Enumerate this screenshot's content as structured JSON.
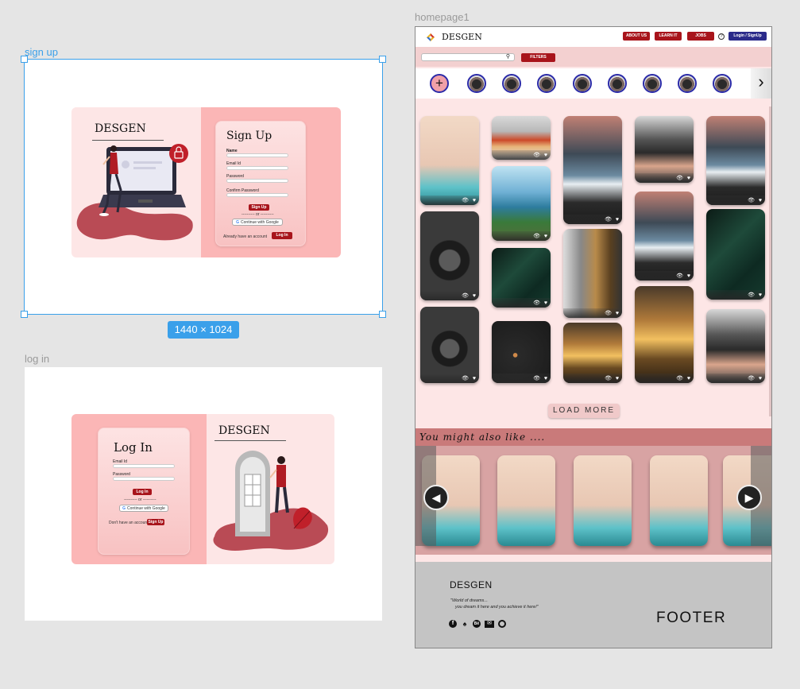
{
  "canvas": {
    "signup_label": "sign up",
    "login_label": "log in",
    "homepage_label": "homepage1",
    "size_tag": "1440 × 1024"
  },
  "signup": {
    "brand": "DESGEN",
    "title": "Sign Up",
    "fields": [
      "Name",
      "Email Id",
      "Password",
      "Confirm Password"
    ],
    "submit": "Sign Up",
    "or": "---------- or ----------",
    "google": "Continue with Google",
    "already": "Already have an account",
    "login_btn": "Log In"
  },
  "login": {
    "brand": "DESGEN",
    "title": "Log In",
    "fields": [
      "Email Id",
      "Password"
    ],
    "submit": "Log In",
    "or": "---------- or ----------",
    "google": "Continue with Google",
    "no_account": "Don't have an account",
    "signup_btn": "Sign Up"
  },
  "homepage": {
    "brand": "DESGEN",
    "nav": [
      "ABOUT US",
      "LEARN IT",
      "JOBS"
    ],
    "help": "?",
    "login_signup": "Login / SignUp",
    "filters": "FILTERS",
    "search_icon": "search-icon",
    "load_more": "LOAD MORE",
    "also_like": "You might also like ....",
    "footer": {
      "brand": "DESGEN",
      "tagline_1": "\"World of dreams...",
      "tagline_2": "you dream it here and you achieve it here!\"",
      "label": "FOOTER",
      "social_icons": [
        "facebook-icon",
        "twitter-icon",
        "behance-icon",
        "mail-icon",
        "github-icon"
      ]
    }
  },
  "colors": {
    "accent_red": "#a8141b",
    "pink": "#fbb6b6",
    "light_pink": "#fde6e6",
    "selection_blue": "#3aa0ea",
    "login_blue": "#2a2a8a"
  }
}
